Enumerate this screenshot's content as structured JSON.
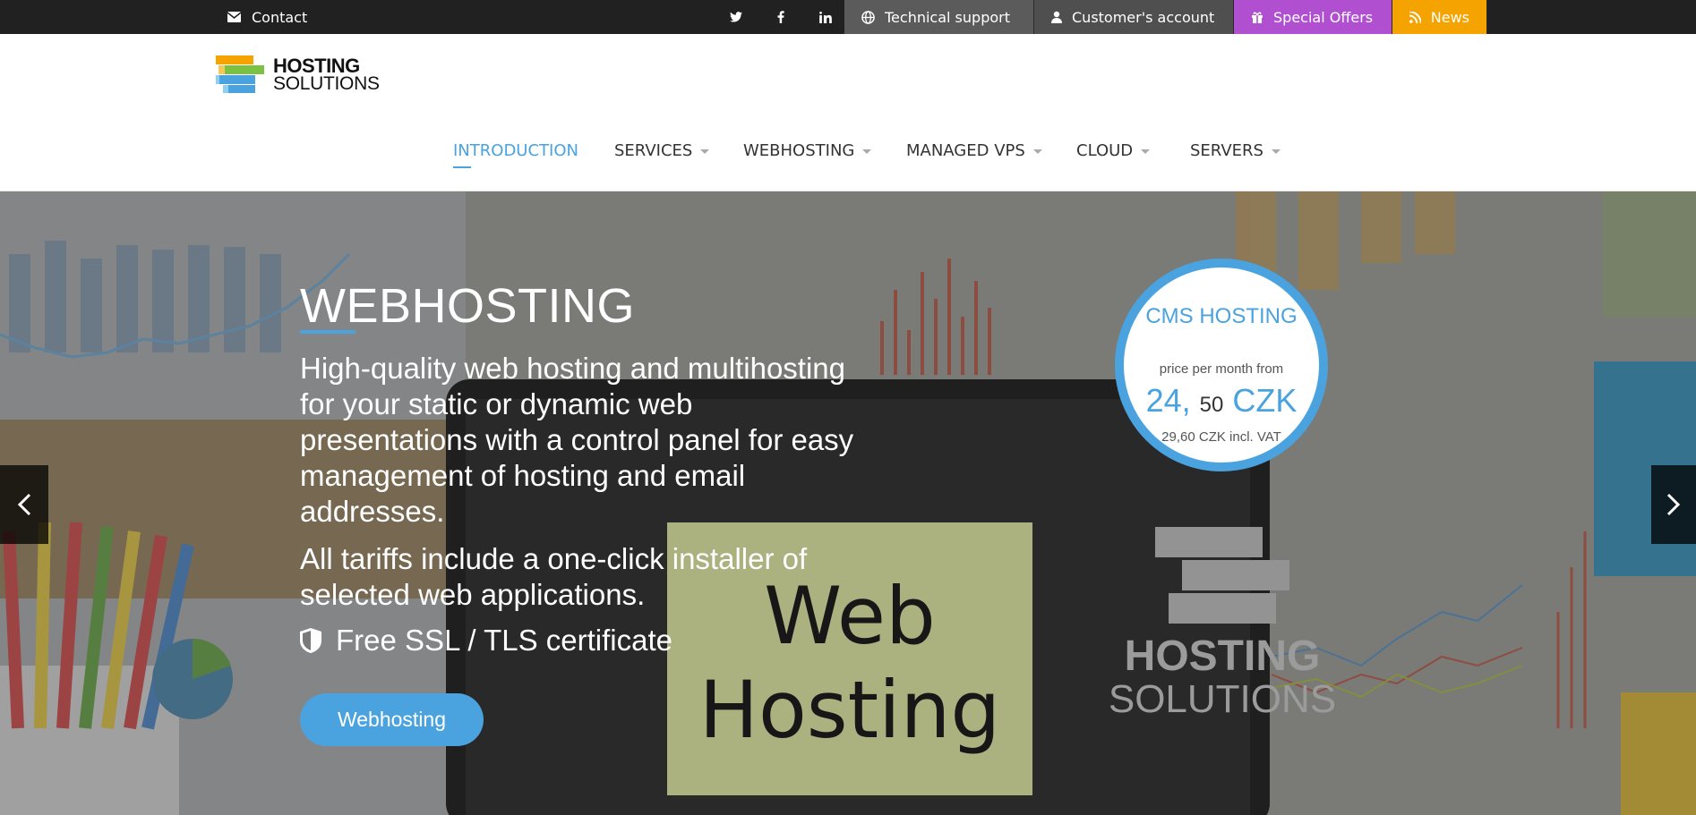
{
  "topbar": {
    "contact_label": "Contact",
    "socials": [
      "twitter-icon",
      "facebook-icon",
      "linkedin-icon"
    ],
    "links": {
      "support": "Technical support",
      "account": "Customer's account",
      "offers": "Special Offers",
      "news": "News"
    }
  },
  "logo": {
    "line1": "HOSTING",
    "line2": "SOLUTIONS"
  },
  "nav": {
    "introduction": "INTRODUCTION",
    "services": "SERVICES",
    "webhosting": "WEBHOSTING",
    "managed_vps": "MANAGED VPS",
    "cloud": "CLOUD",
    "servers": "SERVERS"
  },
  "hero": {
    "title": "WEBHOSTING",
    "paragraph1": "High-quality web hosting and multihosting for your static or dynamic web presentations with a control panel for easy management of hosting and email addresses.",
    "paragraph2": "All tariffs include a one-click installer of selected web applications.",
    "ssl_text": "Free SSL / TLS certificate",
    "button_label": "Webhosting",
    "badge": {
      "title": "CMS HOSTING",
      "subtitle": "price per month from",
      "price_main": "24,",
      "price_cents": "50",
      "currency": "CZK",
      "vat_note": "29,60 CZK incl. VAT"
    },
    "sticky_note": "Web Hosting",
    "watermark_line1": "HOSTING",
    "watermark_line2": "SOLUTIONS"
  },
  "colors": {
    "accent": "#4aa3df",
    "offers": "#b14fd1",
    "news": "#f4a300",
    "topbar": "#212121"
  }
}
